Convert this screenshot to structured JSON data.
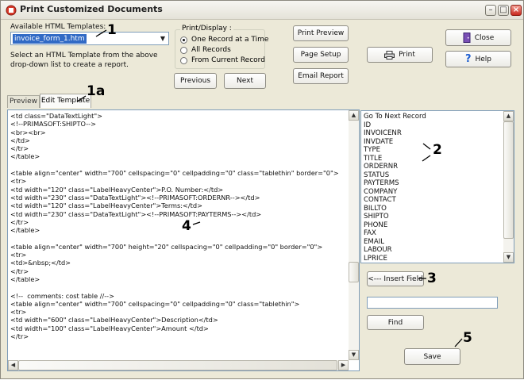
{
  "window": {
    "title": "Print Customized Documents",
    "minimize_glyph": "–",
    "maximize_glyph": "□",
    "close_glyph": "×",
    "close_color": "#c8281e"
  },
  "templates": {
    "label": "Available HTML Templates:",
    "selected": "invoice_form_1.htm",
    "help_line1": "Select an HTML Template from the above",
    "help_line2": "drop-down list to create a report."
  },
  "print_display": {
    "title": "Print/Display :",
    "options": [
      "One Record at a Time",
      "All Records",
      "From Current Record"
    ],
    "selected_index": 0
  },
  "buttons": {
    "previous": "Previous",
    "next": "Next",
    "print_preview": "Print Preview",
    "page_setup": "Page Setup",
    "email_report": "Email Report",
    "print": "Print",
    "close": "Close",
    "help": "Help",
    "insert_field": "<--- Insert Field",
    "find": "Find",
    "save": "Save"
  },
  "tabs": [
    "Preview",
    "Edit Template"
  ],
  "active_tab": 1,
  "editor_lines": [
    "<td class=\"DataTextLight\">",
    "<!--PRIMASOFT:SHIPTO-->",
    "<br><br>",
    "</td>",
    "</tr>",
    "</table>",
    "",
    "<table align=\"center\" width=\"700\" cellspacing=\"0\" cellpadding=\"0\" class=\"tablethin\" border=\"0\">",
    "<tr>",
    "<td width=\"120\" class=\"LabelHeavyCenter\">P.O. Number:</td>",
    "<td width=\"230\" class=\"DataTextLight\"><!--PRIMASOFT:ORDERNR--></td>",
    "<td width=\"120\" class=\"LabelHeavyCenter\">Terms:</td>",
    "<td width=\"230\" class=\"DataTextLight\"><!--PRIMASOFT:PAYTERMS--></td>",
    "</tr>",
    "</table>",
    "",
    "<table align=\"center\" width=\"700\" height=\"20\" cellspacing=\"0\" cellpadding=\"0\" border=\"0\">",
    "<tr>",
    "<td>&nbsp;</td>",
    "</tr>",
    "</table>",
    "",
    "<!--  comments: cost table //-->",
    "<table align=\"center\" width=\"700\" cellspacing=\"0\" cellpadding=\"0\" class=\"tablethin\">",
    "<tr>",
    "<td width=\"600\" class=\"LabelHeavyCenter\">Description</td>",
    "<td width=\"100\" class=\"LabelHeavyCenter\">Amount </td>",
    "</tr>"
  ],
  "fields": [
    "Go To Next Record",
    "ID",
    "INVOICENR",
    "INVDATE",
    "TYPE",
    "TITLE",
    "ORDERNR",
    "STATUS",
    "PAYTERMS",
    "COMPANY",
    "CONTACT",
    "BILLTO",
    "SHIPTO",
    "PHONE",
    "FAX",
    "EMAIL",
    "LABOUR",
    "LPRICE"
  ],
  "find_value": "",
  "annotations": [
    "1",
    "1a",
    "2",
    "3",
    "4",
    "5"
  ],
  "colors": {
    "window_bg": "#ece9d8",
    "selection": "#316ac5",
    "field_border": "#7f9db9"
  }
}
